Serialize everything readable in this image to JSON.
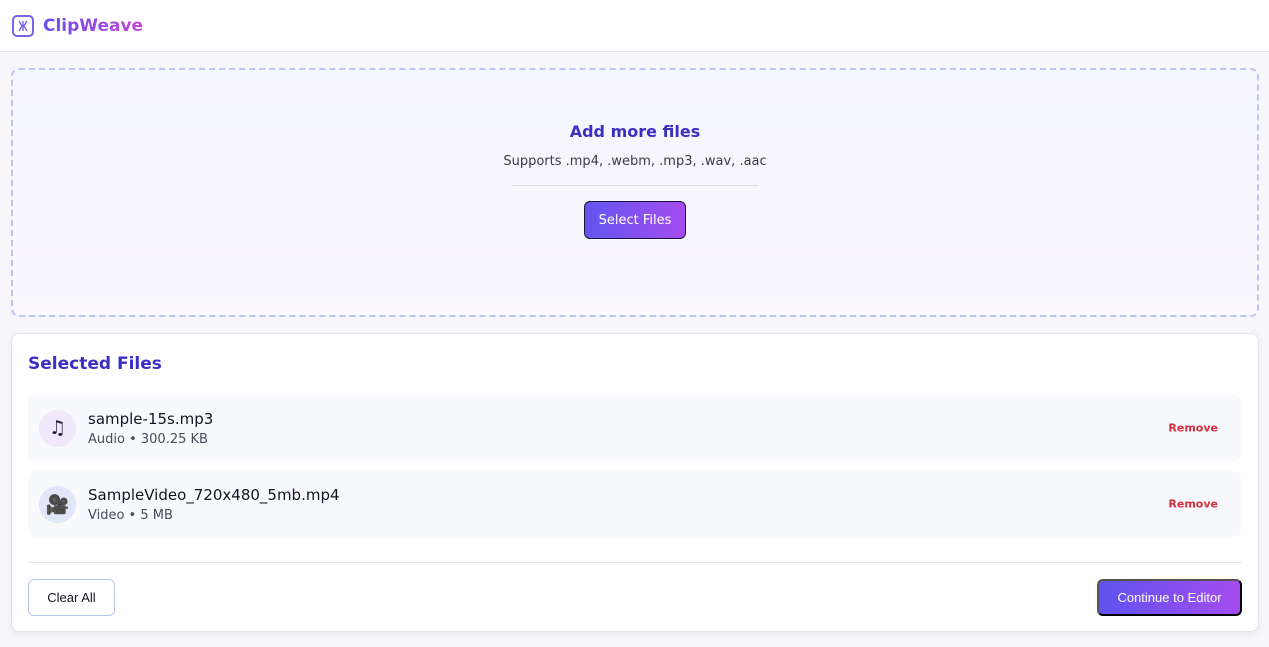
{
  "app": {
    "name": "ClipWeave",
    "icon": "film-weave-icon",
    "brand_gradient": [
      "#6a4cf0",
      "#c247d6"
    ]
  },
  "dropzone": {
    "title": "Add more files",
    "subtitle": "Supports .mp4, .webm, .mp3, .wav, .aac",
    "select_label": "Select Files"
  },
  "selected": {
    "title": "Selected Files",
    "files": [
      {
        "name": "sample-15s.mp3",
        "meta": "Audio • 300.25 KB",
        "icon": "music-note-icon",
        "icon_glyph": "♫",
        "remove_label": "Remove"
      },
      {
        "name": "SampleVideo_720x480_5mb.mp4",
        "meta": "Video • 5 MB",
        "icon": "video-camera-icon",
        "icon_glyph": "🎥",
        "remove_label": "Remove"
      }
    ],
    "clear_label": "Clear All",
    "continue_label": "Continue to Editor"
  },
  "colors": {
    "accent": "#3b2fc4",
    "remove": "#d62f3b"
  }
}
